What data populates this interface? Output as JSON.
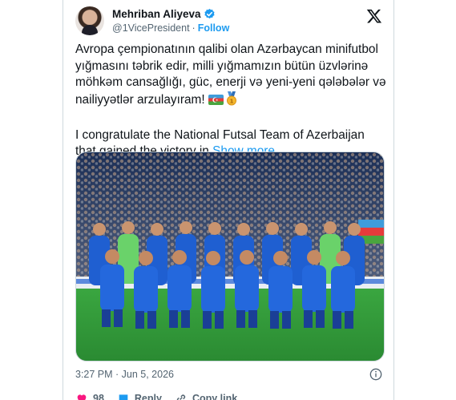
{
  "post": {
    "author_name": "Mehriban Aliyeva",
    "handle": "@1VicePresident",
    "separator": "·",
    "follow_label": "Follow",
    "text_az": "Avropa çempionatının qalibi olan Azərbaycan minifutbol yığmasını təbrik edir, milli yığmamızın bütün üzvlərinə möhkəm cansağlığı, güc, enerji və yeni-yeni qələbələr və nailiyyətlər arzulayıram!",
    "text_en": "I congratulate the National Futsal Team of Azerbaijan that gained the victory in",
    "show_more_label": "Show more",
    "timestamp": "3:27 PM · Jun 5, 2026",
    "like_count": "98",
    "reply_label": "Reply",
    "copy_link_label": "Copy link"
  },
  "icons": {
    "verified": "verified-badge-icon",
    "x_logo": "x-logo-icon",
    "flag": "azerbaijan-flag-icon",
    "medal": "gold-medal-icon",
    "info": "info-icon",
    "like": "heart-icon",
    "reply": "reply-bubble-icon",
    "copy": "link-icon"
  },
  "colors": {
    "accent": "#1d9bf0",
    "like": "#f91880",
    "jersey": "#1f5fd1",
    "pitch": "#2f9a3a"
  }
}
